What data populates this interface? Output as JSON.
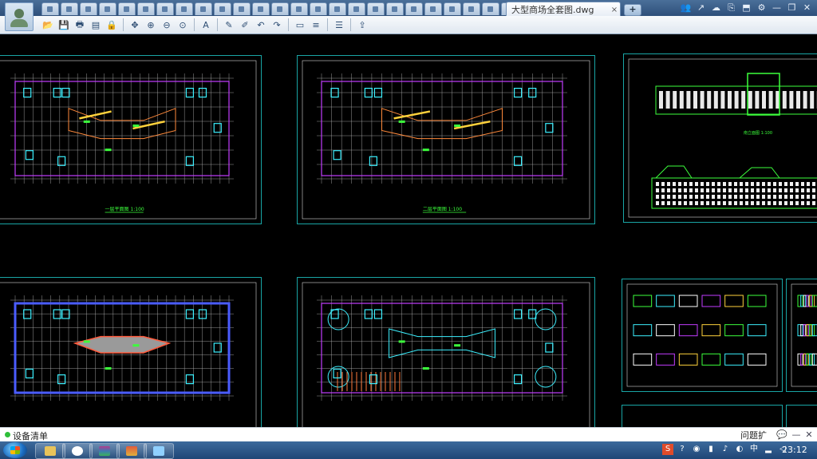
{
  "app": {
    "active_tab_title": "大型商场全套图.dwg",
    "new_tab_label": "+",
    "tab_close": "×",
    "mini_tab_count": 30
  },
  "window_tools": [
    "👥",
    "↗",
    "☁",
    "⎘",
    "⬒",
    "⚙",
    "—",
    "❐",
    "✕"
  ],
  "toolbar": {
    "icons": [
      "open-icon",
      "save-icon",
      "print-icon",
      "pdf-icon",
      "lock-icon",
      "pan-icon",
      "zoom-in-icon",
      "zoom-out-icon",
      "zoom-extents-icon",
      "text-icon",
      "pen-icon",
      "markup-icon",
      "undo-icon",
      "redo-icon",
      "measure-icon",
      "dimension-icon",
      "layers-icon",
      "export-icon"
    ]
  },
  "sheets": [
    {
      "id": "plan-1",
      "label": "一层平面图 1:100"
    },
    {
      "id": "plan-2",
      "label": "二层平面图 1:100"
    },
    {
      "id": "elevation",
      "label": "南立面图 1:100"
    },
    {
      "id": "plan-3",
      "label": ""
    },
    {
      "id": "plan-4",
      "label": ""
    },
    {
      "id": "details-1",
      "label": ""
    },
    {
      "id": "details-2",
      "label": ""
    }
  ],
  "status": {
    "left_text": "设备清单",
    "right_text": "问题扩"
  },
  "taskbar": {
    "clock": "23:12"
  },
  "colors": {
    "frame": "#19a5a5",
    "grid": "#d8d8d8",
    "accent_green": "#3cff3c",
    "accent_magenta": "#c23cff",
    "accent_yellow": "#ffd23c",
    "accent_cyan": "#3cf0ff"
  }
}
